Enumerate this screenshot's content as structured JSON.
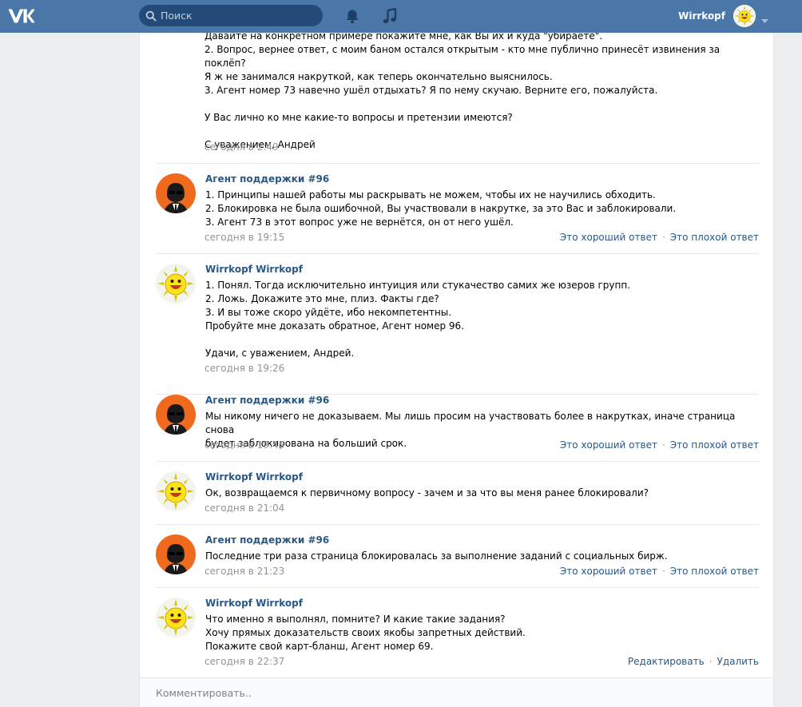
{
  "header": {
    "search_placeholder": "Поиск",
    "user_name": "Wirrkopf",
    "accent_color": "#4a76a8"
  },
  "messages": [
    {
      "author": "",
      "avatar": "",
      "text": "Давайте на конкретном примере покажите мне, как Вы их и куда \"убираете\".\n2. Вопрос, вернее ответ, с моим баном остался открытым - кто мне публично принесёт извинения за поклёп?\nЯ ж не занимался накруткой, как теперь окончательно выяснилось.\n3. Агент номер 73 навечно ушёл отдыхать? Я по нему скучаю. Верните его, пожалуйста.\n\nУ Вас лично ко мне какие-то вопросы и претензии имеются?\n\nС уважением, Андрей",
      "time": "сегодня в 2:49"
    },
    {
      "author": "Агент поддержки #96",
      "avatar": "agent-avatar-icon",
      "text": "1. Принципы нашей работы мы раскрывать не можем, чтобы их не научились обходить.\n2. Блокировка не была ошибочной, Вы участвовали в накрутке, за это Вас и заблокировали.\n3. Агент 73 в этот вопрос уже не вернётся, он от него ушёл.",
      "time": "сегодня в 19:15",
      "actions": [
        "Это хороший ответ",
        "Это плохой ответ"
      ]
    },
    {
      "author": "Wirrkopf Wirrkopf",
      "avatar": "sun-avatar-icon",
      "text": "1. Понял. Тогда исключительно интуиция или стукачество самих же юзеров групп.\n2. Ложь. Докажите это мне, плиз. Факты где?\n3. И вы тоже скоро уйдёте, ибо некомпетентны.\nПробуйте мне доказать обратное, Агент номер 96.\n\nУдачи, с уважением, Андрей.",
      "time": "сегодня в 19:26"
    },
    {
      "author": "Агент поддержки #96",
      "avatar": "agent-avatar-icon",
      "text": "Мы никому ничего не доказываем. Мы лишь просим на участвовать более в накрутках, иначе страница снова\nбудет заблокирована на больший срок.",
      "time": "сегодня в 19:45",
      "actions": [
        "Это хороший ответ",
        "Это плохой ответ"
      ]
    },
    {
      "author": "Wirrkopf Wirrkopf",
      "avatar": "sun-avatar-icon",
      "text": "Ок, возвращаемся к первичному вопросу - зачем и за что вы меня ранее блокировали?",
      "time": "сегодня в 21:04"
    },
    {
      "author": "Агент поддержки #96",
      "avatar": "agent-avatar-icon",
      "text": "Последние три раза страница блокировалась за выполнение заданий с социальных бирж.",
      "time": "сегодня в 21:23",
      "actions": [
        "Это хороший ответ",
        "Это плохой ответ"
      ]
    },
    {
      "author": "Wirrkopf Wirrkopf",
      "avatar": "sun-avatar-icon",
      "text": "Что именно я выполнял, помните? И какие такие задания?\nХочу прямых доказательств своих якобы запретных действий.\nПокажите свой карт-бланш, Агент номер 69.",
      "time": "сегодня в 22:37",
      "actions": [
        "Редактировать",
        "Удалить"
      ]
    }
  ],
  "composer": {
    "placeholder": "Комментировать.."
  }
}
